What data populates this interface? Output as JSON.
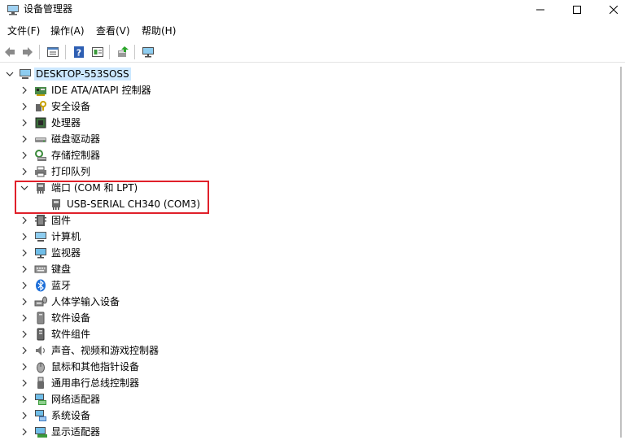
{
  "window": {
    "title": "设备管理器"
  },
  "menu": [
    {
      "label": "文件(F)"
    },
    {
      "label": "操作(A)"
    },
    {
      "label": "查看(V)"
    },
    {
      "label": "帮助(H)"
    }
  ],
  "toolbar": {
    "icons": [
      "back-arrow-icon",
      "forward-arrow-icon",
      "properties-icon",
      "help-icon",
      "show-hidden-icon",
      "update-driver-icon",
      "monitor-icon"
    ]
  },
  "tree": {
    "root": {
      "label": "DESKTOP-553SOSS",
      "expanded": true
    },
    "categories": [
      {
        "label": "IDE ATA/ATAPI 控制器",
        "icon": "ide-controller-icon"
      },
      {
        "label": "安全设备",
        "icon": "security-device-icon"
      },
      {
        "label": "处理器",
        "icon": "processor-icon"
      },
      {
        "label": "磁盘驱动器",
        "icon": "disk-drive-icon"
      },
      {
        "label": "存储控制器",
        "icon": "storage-controller-icon"
      },
      {
        "label": "打印队列",
        "icon": "printer-icon"
      },
      {
        "label": "端口 (COM 和 LPT)",
        "icon": "port-icon",
        "expanded": true
      },
      {
        "label": "固件",
        "icon": "firmware-icon"
      },
      {
        "label": "计算机",
        "icon": "computer-icon"
      },
      {
        "label": "监视器",
        "icon": "monitor-icon"
      },
      {
        "label": "键盘",
        "icon": "keyboard-icon"
      },
      {
        "label": "蓝牙",
        "icon": "bluetooth-icon"
      },
      {
        "label": "人体学输入设备",
        "icon": "hid-icon"
      },
      {
        "label": "软件设备",
        "icon": "software-device-icon"
      },
      {
        "label": "软件组件",
        "icon": "software-component-icon"
      },
      {
        "label": "声音、视频和游戏控制器",
        "icon": "speaker-icon"
      },
      {
        "label": "鼠标和其他指针设备",
        "icon": "mouse-icon"
      },
      {
        "label": "通用串行总线控制器",
        "icon": "usb-icon"
      },
      {
        "label": "网络适配器",
        "icon": "network-adapter-icon"
      },
      {
        "label": "系统设备",
        "icon": "system-device-icon"
      },
      {
        "label": "显示适配器",
        "icon": "display-adapter-icon"
      }
    ],
    "port_children": [
      {
        "label": "USB-SERIAL CH340 (COM3)",
        "icon": "serial-port-icon"
      }
    ]
  },
  "colors": {
    "selection": "#cce8ff",
    "highlight_box": "#e0202a"
  }
}
